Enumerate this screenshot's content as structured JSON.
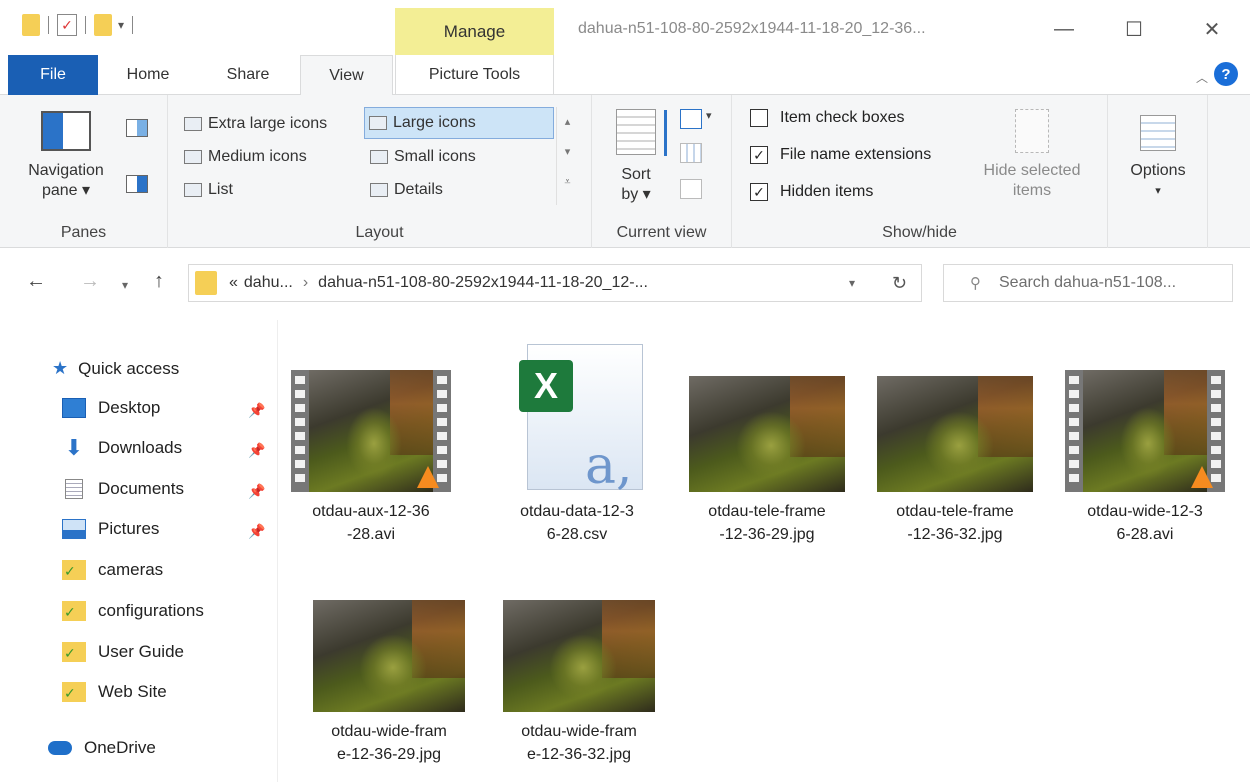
{
  "window": {
    "title": "dahua-n51-108-80-2592x1944-11-18-20_12-36...",
    "minimize_glyph": "—",
    "maximize_glyph": "☐",
    "close_glyph": "✕"
  },
  "tabs": {
    "file": "File",
    "home": "Home",
    "share": "Share",
    "view": "View",
    "manage": "Manage",
    "picture_tools": "Picture Tools",
    "active": "View"
  },
  "ribbon": {
    "panes": {
      "navigation_pane_label": "Navigation",
      "navigation_pane_label2": "pane ▾",
      "group_label": "Panes"
    },
    "layout": {
      "items": [
        {
          "label": "Extra large icons"
        },
        {
          "label": "Large icons",
          "selected": true
        },
        {
          "label": "Medium icons"
        },
        {
          "label": "Small icons"
        },
        {
          "label": "List"
        },
        {
          "label": "Details"
        }
      ],
      "group_label": "Layout"
    },
    "current_view": {
      "sort_label": "Sort",
      "sort_label2": "by ▾",
      "group_label": "Current view"
    },
    "show_hide": {
      "item_check_boxes": {
        "label": "Item check boxes",
        "checked": false
      },
      "file_name_extensions": {
        "label": "File name extensions",
        "checked": true
      },
      "hidden_items": {
        "label": "Hidden items",
        "checked": true
      },
      "hide_selected_label": "Hide selected",
      "hide_selected_label2": "items",
      "group_label": "Show/hide"
    },
    "options": {
      "label": "Options",
      "caret": "▾"
    }
  },
  "address": {
    "prefix": "«",
    "crumb_parent": "dahu...",
    "sep": "›",
    "crumb_current": "dahua-n51-108-80-2592x1944-11-18-20_12-...",
    "search_placeholder": "Search dahua-n51-108..."
  },
  "navpane": {
    "quick_access": "Quick access",
    "items": [
      {
        "label": "Desktop",
        "pinned": true
      },
      {
        "label": "Downloads",
        "pinned": true
      },
      {
        "label": "Documents",
        "pinned": true
      },
      {
        "label": "Pictures",
        "pinned": true
      },
      {
        "label": "cameras"
      },
      {
        "label": "configurations"
      },
      {
        "label": "User Guide"
      },
      {
        "label": "Web Site"
      }
    ],
    "onedrive": "OneDrive"
  },
  "files": [
    {
      "name": "otdau-aux-12-36\n-28.avi",
      "type": "video"
    },
    {
      "name": "otdau-data-12-3\n6-28.csv",
      "type": "csv"
    },
    {
      "name": "otdau-tele-frame\n-12-36-29.jpg",
      "type": "image"
    },
    {
      "name": "otdau-tele-frame\n-12-36-32.jpg",
      "type": "image"
    },
    {
      "name": "otdau-wide-12-3\n6-28.avi",
      "type": "video"
    },
    {
      "name": "otdau-wide-fram\ne-12-36-29.jpg",
      "type": "image"
    },
    {
      "name": "otdau-wide-fram\ne-12-36-32.jpg",
      "type": "image"
    }
  ],
  "colors": {
    "file_tab": "#1a5fb4",
    "manage_tab": "#f3ee95",
    "selection": "#cde4f7",
    "folder": "#f5cf56"
  }
}
